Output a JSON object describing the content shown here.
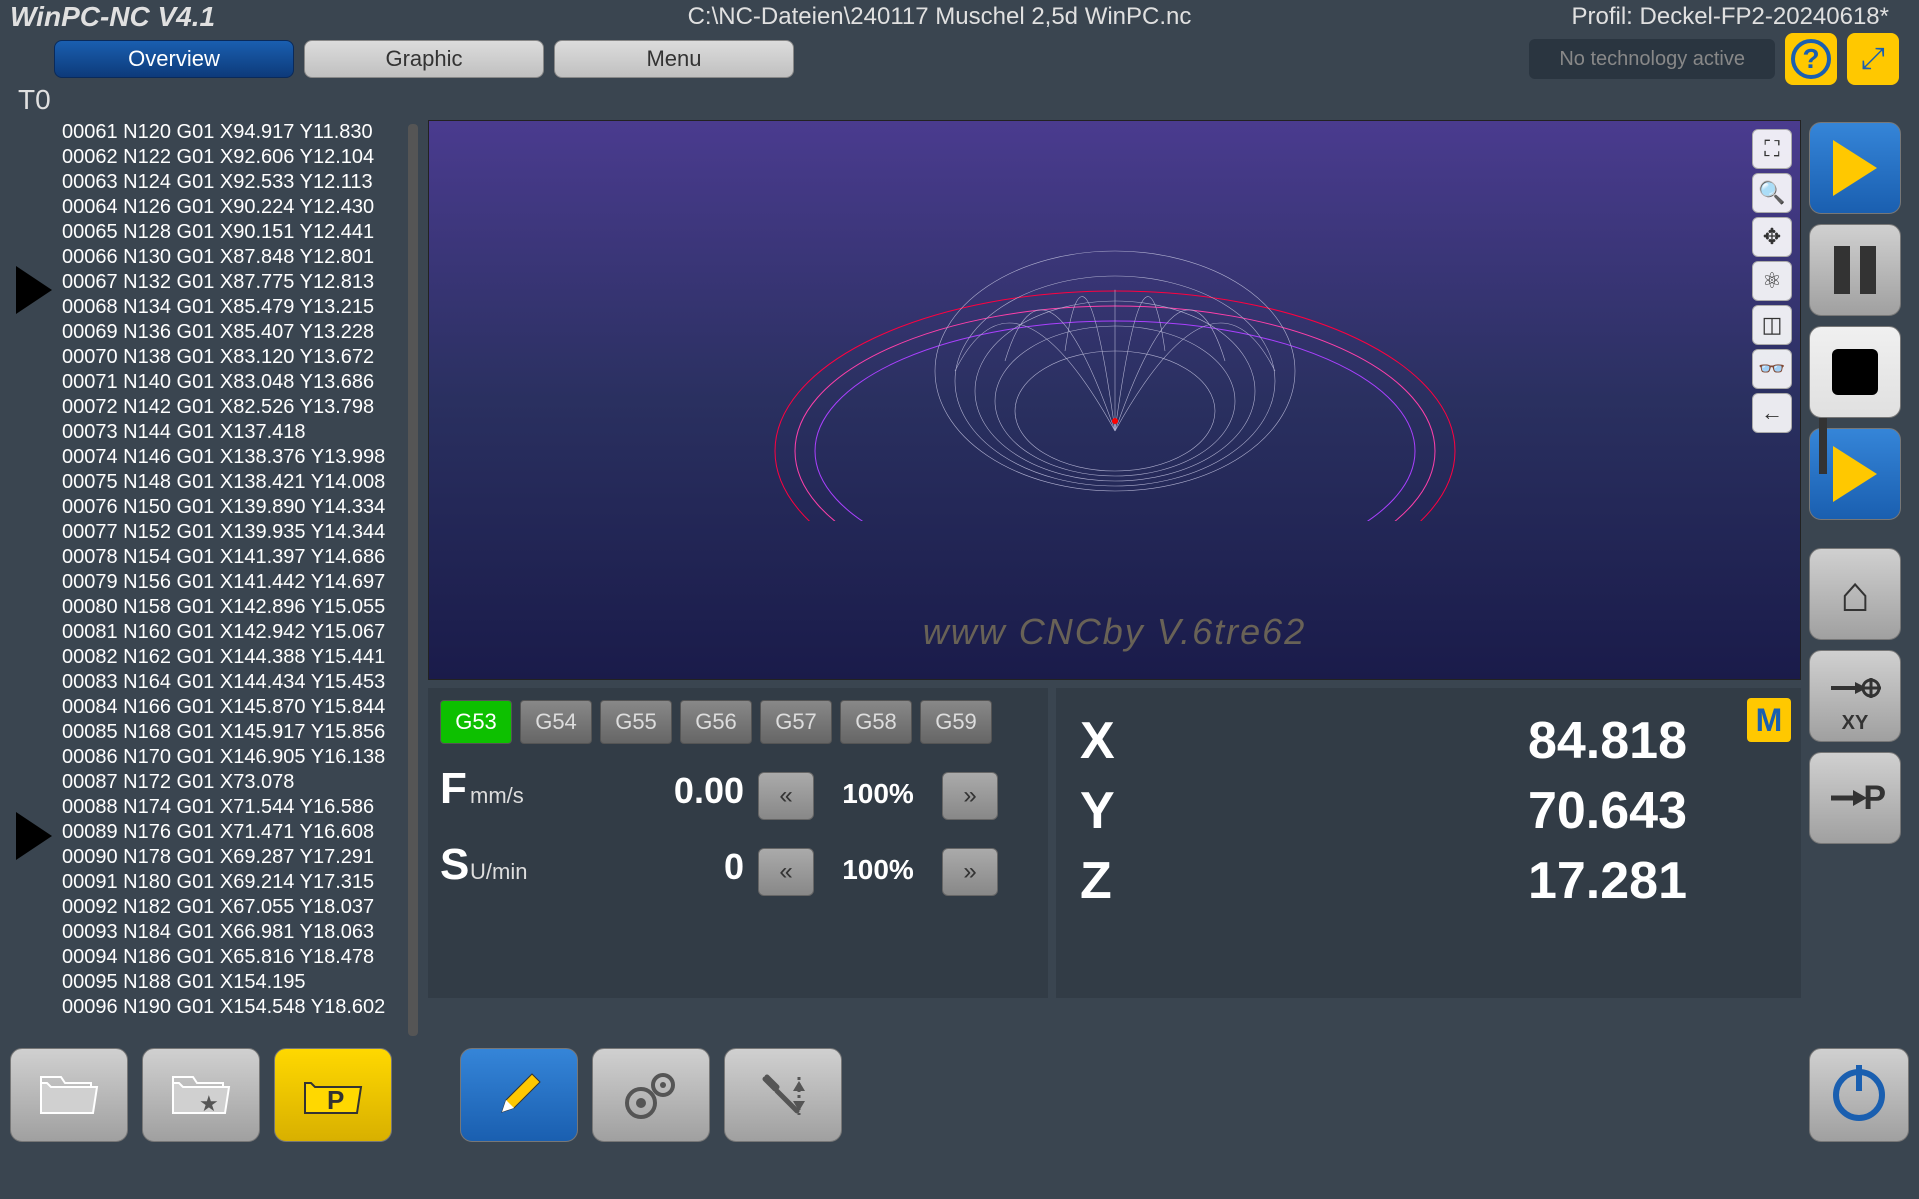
{
  "header": {
    "app_title": "WinPC-NC V4.1",
    "file_path": "C:\\NC-Dateien\\240117 Muschel 2,5d WinPC.nc",
    "profile": "Profil: Deckel-FP2-20240618*"
  },
  "tabs": {
    "overview": "Overview",
    "graphic": "Graphic",
    "menu": "Menu"
  },
  "tech_status": "No technology active",
  "tool_label": "T0",
  "gcode_lines": [
    "00061 N120 G01 X94.917 Y11.830",
    "00062 N122 G01 X92.606 Y12.104",
    "00063 N124 G01 X92.533 Y12.113",
    "00064 N126 G01 X90.224 Y12.430",
    "00065 N128 G01 X90.151 Y12.441",
    "00066 N130 G01 X87.848 Y12.801",
    "00067 N132 G01 X87.775 Y12.813",
    "00068 N134 G01 X85.479 Y13.215",
    "00069 N136 G01 X85.407 Y13.228",
    "00070 N138 G01 X83.120 Y13.672",
    "00071 N140 G01 X83.048 Y13.686",
    "00072 N142 G01 X82.526 Y13.798",
    "00073 N144 G01 X137.418",
    "00074 N146 G01 X138.376 Y13.998",
    "00075 N148 G01 X138.421 Y14.008",
    "00076 N150 G01 X139.890 Y14.334",
    "00077 N152 G01 X139.935 Y14.344",
    "00078 N154 G01 X141.397 Y14.686",
    "00079 N156 G01 X141.442 Y14.697",
    "00080 N158 G01 X142.896 Y15.055",
    "00081 N160 G01 X142.942 Y15.067",
    "00082 N162 G01 X144.388 Y15.441",
    "00083 N164 G01 X144.434 Y15.453",
    "00084 N166 G01 X145.870 Y15.844",
    "00085 N168 G01 X145.917 Y15.856",
    "00086 N170 G01 X146.905 Y16.138",
    "00087 N172 G01 X73.078",
    "00088 N174 G01 X71.544 Y16.586",
    "00089 N176 G01 X71.471 Y16.608",
    "00090 N178 G01 X69.287 Y17.291",
    "00091 N180 G01 X69.214 Y17.315",
    "00092 N182 G01 X67.055 Y18.037",
    "00093 N184 G01 X66.981 Y18.063",
    "00094 N186 G01 X65.816 Y18.478",
    "00095 N188 G01 X154.195",
    "00096 N190 G01 X154.548 Y18.602"
  ],
  "coord_systems": [
    "G53",
    "G54",
    "G55",
    "G56",
    "G57",
    "G58",
    "G59"
  ],
  "coord_active": "G53",
  "feed": {
    "f_label": "F",
    "f_unit": "mm/s",
    "f_value": "0.00",
    "f_pct": "100%",
    "s_label": "S",
    "s_unit": "U/min",
    "s_value": "0",
    "s_pct": "100%"
  },
  "position": {
    "x_label": "X",
    "x_val": "84.818",
    "y_label": "Y",
    "y_val": "70.643",
    "z_label": "Z",
    "z_val": "17.281",
    "m_badge": "M"
  },
  "right_labels": {
    "xy": "XY",
    "p": "P"
  },
  "watermark": "www CNCby V.6tre62"
}
